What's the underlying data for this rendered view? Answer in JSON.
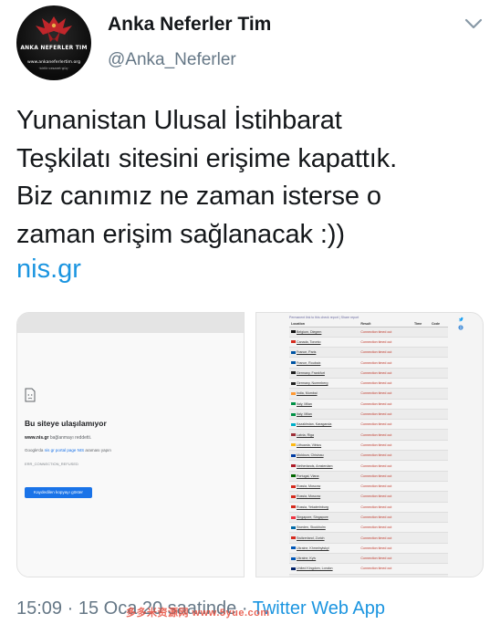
{
  "author": {
    "display_name": "Anka Neferler Tim",
    "handle": "@Anka_Neferler",
    "avatar": {
      "name": "ANKA NEFERLER TIM",
      "site": "www.ankaneferlertim.org",
      "motto": "·birlik·cesaret·güç·"
    }
  },
  "icons": {
    "menu": "chevron-down-icon",
    "error_page": "sad-document-icon",
    "twitter": "twitter-bird-icon",
    "info": "info-icon"
  },
  "tweet": {
    "lines": [
      "Yunanistan Ulusal İstihbarat",
      "Teşkilatı sitesini erişime kapattık.",
      "Biz canımız ne zaman isterse o",
      "zaman erişim sağlanacak :))"
    ],
    "link": "nis.gr"
  },
  "media_left": {
    "title": "Bu siteye ulaşılamıyor",
    "line1_domain": "www.nis.gr",
    "line1_rest": " bağlanmayı reddetti.",
    "line2_prefix": "Google'da ",
    "line2_link": "nis gr portal page NIS",
    "line2_suffix": " araması yapın",
    "error_code": "ERR_CONNECTION_REFUSED",
    "button_label": "Kaydedilen kopyayı göster"
  },
  "media_right": {
    "note": "Permanent link to this check report | Share report",
    "headers": [
      "Location",
      "Result",
      "Time",
      "Code"
    ],
    "rows": [
      {
        "location": "Belgium, Diegem",
        "result": "Connection timed out",
        "flag": "#111111"
      },
      {
        "location": "Canada, Toronto",
        "result": "Connection timed out",
        "flag": "#d52b1e"
      },
      {
        "location": "France, Paris",
        "result": "Connection timed out",
        "flag": "#0055a4"
      },
      {
        "location": "France, Roubaix",
        "result": "Connection timed out",
        "flag": "#0055a4"
      },
      {
        "location": "Germany, Frankfurt",
        "result": "Connection timed out",
        "flag": "#222222"
      },
      {
        "location": "Germany, Nuremberg",
        "result": "Connection timed out",
        "flag": "#222222"
      },
      {
        "location": "India, Mumbai",
        "result": "Connection timed out",
        "flag": "#ff9933"
      },
      {
        "location": "Italy, Milan",
        "result": "Connection timed out",
        "flag": "#009246"
      },
      {
        "location": "Italy, Milan",
        "result": "Connection timed out",
        "flag": "#009246"
      },
      {
        "location": "Kazakhstan, Karaganda",
        "result": "Connection timed out",
        "flag": "#00afca"
      },
      {
        "location": "Latvia, Riga",
        "result": "Connection timed out",
        "flag": "#9e3039"
      },
      {
        "location": "Lithuania, Vilnius",
        "result": "Connection timed out",
        "flag": "#fdb913"
      },
      {
        "location": "Moldova, Chisinau",
        "result": "Connection timed out",
        "flag": "#003da5"
      },
      {
        "location": "Netherlands, Amsterdam",
        "result": "Connection timed out",
        "flag": "#ae1c28"
      },
      {
        "location": "Portugal, Viana",
        "result": "Connection timed out",
        "flag": "#006600"
      },
      {
        "location": "Russia, Moscow",
        "result": "Connection timed out",
        "flag": "#d52b1e"
      },
      {
        "location": "Russia, Moscow",
        "result": "Connection timed out",
        "flag": "#d52b1e"
      },
      {
        "location": "Russia, Yekaterinburg",
        "result": "Connection timed out",
        "flag": "#d52b1e"
      },
      {
        "location": "Singapore, Singapore",
        "result": "Connection timed out",
        "flag": "#ef3340"
      },
      {
        "location": "Sweden, Stockholm",
        "result": "Connection timed out",
        "flag": "#006aa7"
      },
      {
        "location": "Switzerland, Zurich",
        "result": "Connection timed out",
        "flag": "#d52b1e"
      },
      {
        "location": "Ukraine, Khmelnytskyi",
        "result": "Connection timed out",
        "flag": "#0057b7"
      },
      {
        "location": "Ukraine, Kyiv",
        "result": "Connection timed out",
        "flag": "#0057b7"
      },
      {
        "location": "United Kingdom, London",
        "result": "Connection timed out",
        "flag": "#012169"
      },
      {
        "location": "USA, Dallas",
        "result": "Connection timed out",
        "flag": "#3c3b6e"
      }
    ]
  },
  "footer": {
    "time": "15:09",
    "separator": " · ",
    "date": "15 Oca 20 saatinde",
    "separator2": " · ",
    "app": "Twitter Web App"
  },
  "watermark": "多多米资源网 www.5yue.com"
}
